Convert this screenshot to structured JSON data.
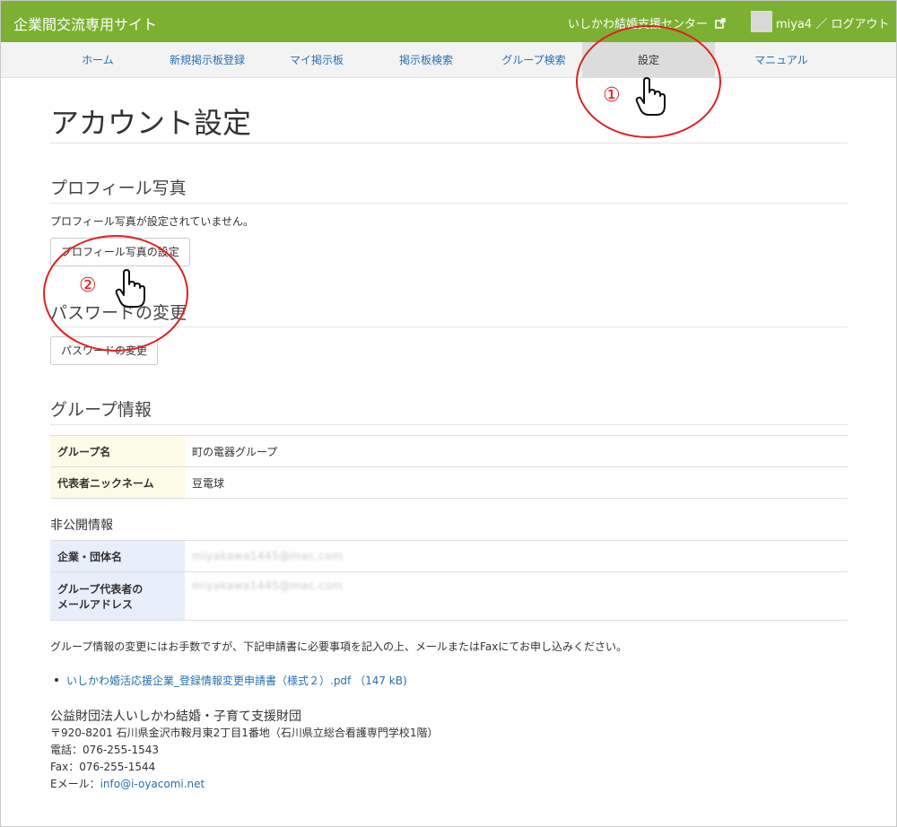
{
  "header": {
    "site_title": "企業間交流専用サイト",
    "center_link": "いしかわ結婚支援センター",
    "user": "miya4",
    "separator": "／",
    "logout": "ログアウト"
  },
  "nav": {
    "items": [
      {
        "label": "ホーム"
      },
      {
        "label": "新規掲示板登録"
      },
      {
        "label": "マイ掲示板"
      },
      {
        "label": "掲示板検索"
      },
      {
        "label": "グループ検索"
      },
      {
        "label": "設定"
      },
      {
        "label": "マニュアル"
      }
    ]
  },
  "page": {
    "title": "アカウント設定"
  },
  "profile": {
    "heading": "プロフィール写真",
    "status": "プロフィール写真が設定されていません。",
    "button": "プロフィール写真の設定"
  },
  "password": {
    "heading": "パスワードの変更",
    "button": "パスワードの変更"
  },
  "group": {
    "heading": "グループ情報",
    "rows": [
      {
        "label": "グループ名",
        "value": "町の電器グループ"
      },
      {
        "label": "代表者ニックネーム",
        "value": "豆電球"
      }
    ]
  },
  "private": {
    "heading": "非公開情報",
    "rows": [
      {
        "label": "企業・団体名",
        "value": "miyakawa1445@mac.com"
      },
      {
        "label_line1": "グループ代表者の",
        "label_line2": "メールアドレス",
        "value": "miyakawa1445@mac.com"
      }
    ]
  },
  "notice": {
    "text": "グループ情報の変更にはお手数ですが、下記申請書に必要事項を記入の上、メールまたはFaxにてお申し込みください。",
    "link": "いしかわ婚活応援企業_登録情報変更申請書（様式２）.pdf （147 kB)"
  },
  "footer": {
    "org": "公益財団法人いしかわ結婚・子育て支援財団",
    "address": "〒920-8201 石川県金沢市鞍月東2丁目1番地（石川県立総合看護専門学校1階）",
    "tel": "電話：076-255-1543",
    "fax": "Fax：076-255-1544",
    "email_label": "Eメール：",
    "email": "info@i-oyacomi.net"
  },
  "annotations": {
    "step1": "①",
    "step2": "②"
  },
  "colors": {
    "header": "#7cb032",
    "link": "#2a6fb0",
    "annotation": "#e02020"
  }
}
